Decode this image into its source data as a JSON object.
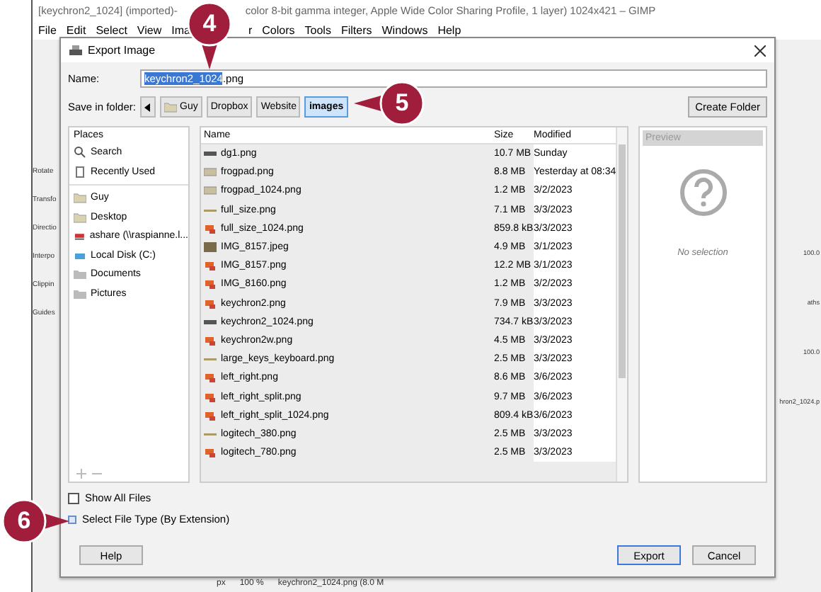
{
  "gimp": {
    "title_start": "[keychron2_1024] (imported)-",
    "title_end": "color 8-bit gamma integer, Apple Wide Color Sharing Profile, 1 layer) 1024x421 – GIMP",
    "menu": [
      "File",
      "Edit",
      "Select",
      "View",
      "Ima",
      "r",
      "Colors",
      "Tools",
      "Filters",
      "Windows",
      "Help"
    ],
    "left_dock": [
      "Rotate",
      "Transfo",
      "Directio",
      "Interpo",
      "Clippin",
      "Guides"
    ],
    "right_dock": [
      "100.0",
      "aths",
      "100.0",
      "hron2_1024.p"
    ],
    "status": [
      "px",
      "100 %",
      "keychron2_1024.png (8.0 M"
    ]
  },
  "dialog": {
    "title": "Export Image",
    "name_label": "Name:",
    "name_selected": "keychron2_1024",
    "name_rest": ".png",
    "folder_label": "Save in folder:",
    "path": [
      {
        "label": "Guy",
        "selected": false,
        "kind": "folder"
      },
      {
        "label": "Dropbox",
        "selected": false,
        "kind": "plain"
      },
      {
        "label": "Website",
        "selected": false,
        "kind": "plain"
      },
      {
        "label": "images",
        "selected": true,
        "kind": "plain"
      }
    ],
    "create_folder": "Create Folder",
    "places_header": "Places",
    "places": [
      {
        "label": "Search",
        "kind": "search"
      },
      {
        "label": "Recently Used",
        "kind": "recent"
      },
      {
        "label": "Guy",
        "kind": "folder"
      },
      {
        "label": "Desktop",
        "kind": "folder"
      },
      {
        "label": "ashare (\\\\raspianne.l...",
        "kind": "network"
      },
      {
        "label": "Local Disk (C:)",
        "kind": "disk"
      },
      {
        "label": "Documents",
        "kind": "gray"
      },
      {
        "label": "Pictures",
        "kind": "gray"
      }
    ],
    "columns": [
      "Name",
      "Size",
      "Modified"
    ],
    "files": [
      {
        "name": "dg1.png",
        "size": "10.7 MB",
        "modified": "Sunday",
        "kind": "strip"
      },
      {
        "name": "frogpad.png",
        "size": "8.8 MB",
        "modified": "Yesterday at 08:34",
        "kind": "thumb"
      },
      {
        "name": "frogpad_1024.png",
        "size": "1.2 MB",
        "modified": "3/2/2023",
        "kind": "thumb"
      },
      {
        "name": "full_size.png",
        "size": "7.1 MB",
        "modified": "3/3/2023",
        "kind": "line"
      },
      {
        "name": "full_size_1024.png",
        "size": "859.8 kB",
        "modified": "3/3/2023",
        "kind": "gimp"
      },
      {
        "name": "IMG_8157.jpeg",
        "size": "4.9 MB",
        "modified": "3/1/2023",
        "kind": "photo"
      },
      {
        "name": "IMG_8157.png",
        "size": "12.2 MB",
        "modified": "3/1/2023",
        "kind": "gimp"
      },
      {
        "name": "IMG_8160.png",
        "size": "1.2 MB",
        "modified": "3/2/2023",
        "kind": "gimp"
      },
      {
        "name": "keychron2.png",
        "size": "7.9 MB",
        "modified": "3/3/2023",
        "kind": "gimp"
      },
      {
        "name": "keychron2_1024.png",
        "size": "734.7 kB",
        "modified": "3/3/2023",
        "kind": "strip"
      },
      {
        "name": "keychron2w.png",
        "size": "4.5 MB",
        "modified": "3/3/2023",
        "kind": "gimp"
      },
      {
        "name": "large_keys_keyboard.png",
        "size": "2.5 MB",
        "modified": "3/3/2023",
        "kind": "line"
      },
      {
        "name": "left_right.png",
        "size": "8.6 MB",
        "modified": "3/6/2023",
        "kind": "gimp"
      },
      {
        "name": "left_right_split.png",
        "size": "9.7 MB",
        "modified": "3/6/2023",
        "kind": "gimp"
      },
      {
        "name": "left_right_split_1024.png",
        "size": "809.4 kB",
        "modified": "3/6/2023",
        "kind": "gimp"
      },
      {
        "name": "logitech_380.png",
        "size": "2.5 MB",
        "modified": "3/3/2023",
        "kind": "line"
      },
      {
        "name": "logitech_780.png",
        "size": "2.5 MB",
        "modified": "3/3/2023",
        "kind": "gimp"
      }
    ],
    "preview_header": "Preview",
    "preview_empty": "No selection",
    "show_all": {
      "label": "Show All Files",
      "checked": false
    },
    "file_type": {
      "label": "Select File Type (By Extension)",
      "expanded": false
    },
    "buttons": {
      "help": "Help",
      "export": "Export",
      "cancel": "Cancel"
    }
  },
  "callouts": [
    "4",
    "5",
    "6"
  ]
}
